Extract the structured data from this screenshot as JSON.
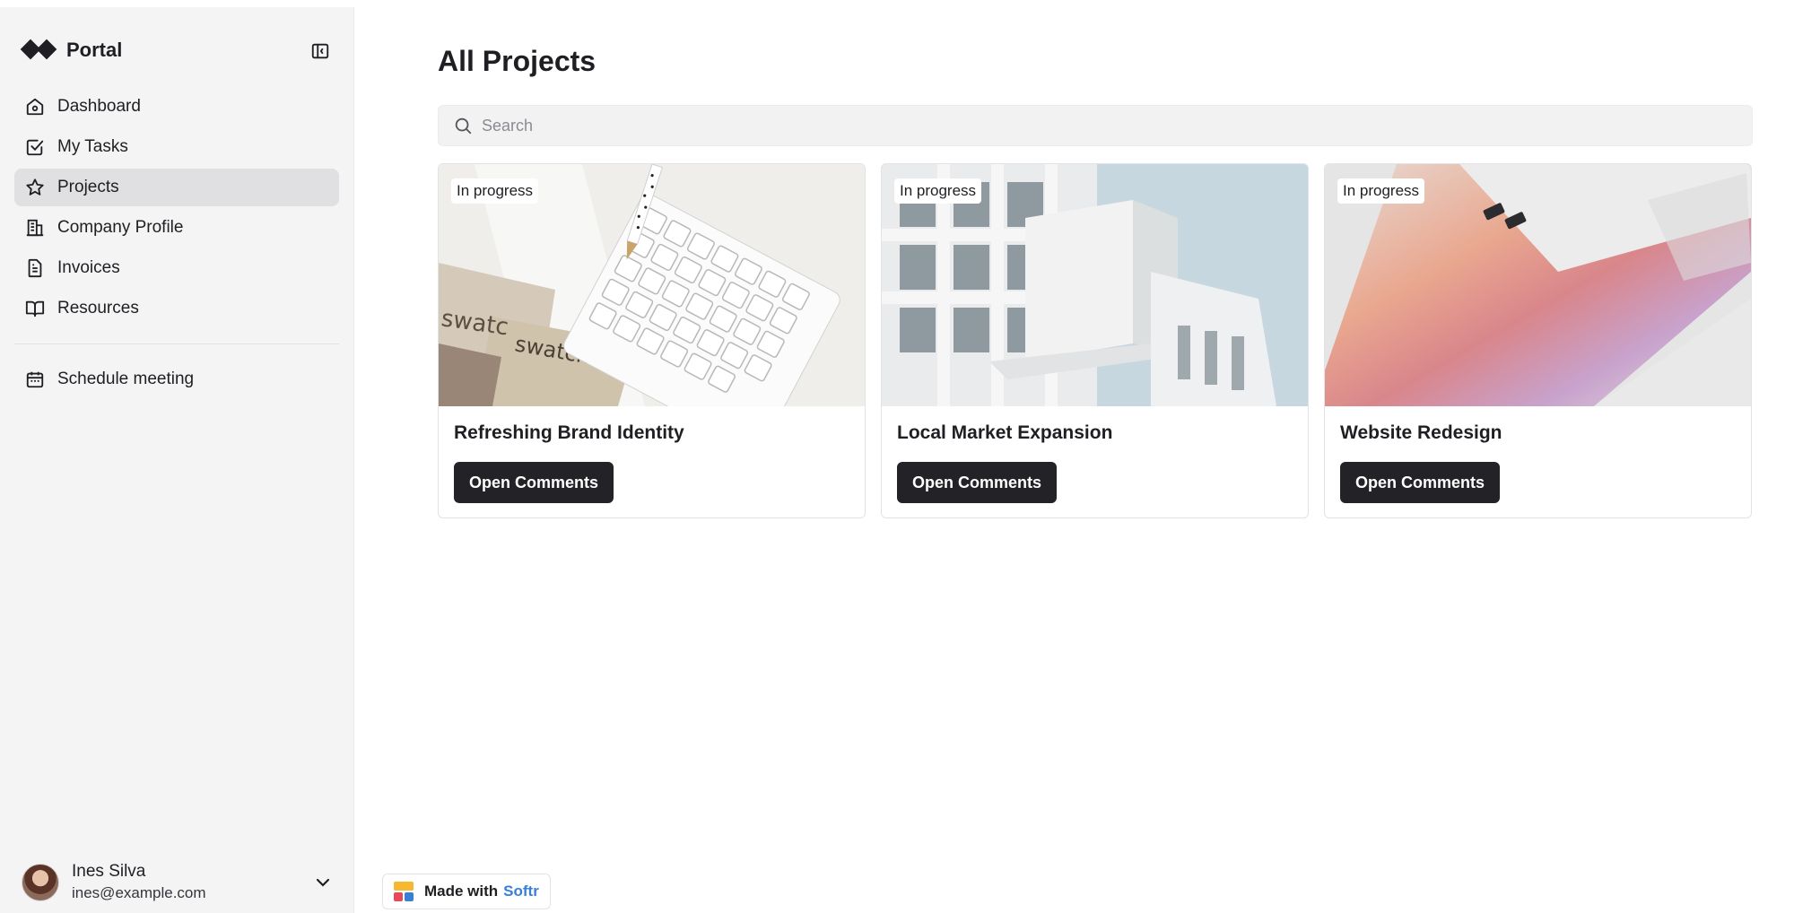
{
  "app": {
    "name": "Portal"
  },
  "sidebar": {
    "items": [
      {
        "label": "Dashboard",
        "icon": "home-icon"
      },
      {
        "label": "My Tasks",
        "icon": "checkbox-icon"
      },
      {
        "label": "Projects",
        "icon": "star-icon",
        "active": true
      },
      {
        "label": "Company Profile",
        "icon": "building-icon"
      },
      {
        "label": "Invoices",
        "icon": "document-icon"
      },
      {
        "label": "Resources",
        "icon": "book-icon"
      }
    ],
    "secondary_items": [
      {
        "label": "Schedule meeting",
        "icon": "calendar-icon"
      }
    ],
    "user": {
      "name": "Ines Silva",
      "email": "ines@example.com"
    }
  },
  "main": {
    "title": "All Projects",
    "search": {
      "placeholder": "Search",
      "value": ""
    },
    "projects": [
      {
        "status": "In progress",
        "title": "Refreshing Brand Identity",
        "button_label": "Open Comments"
      },
      {
        "status": "In progress",
        "title": "Local Market Expansion",
        "button_label": "Open Comments"
      },
      {
        "status": "In progress",
        "title": "Website Redesign",
        "button_label": "Open Comments"
      }
    ]
  },
  "footer_badge": {
    "text": "Made with",
    "brand": "Softr"
  },
  "colors": {
    "sidebar_bg": "#f4f4f5",
    "active_nav_bg": "#e0e0e2",
    "button_bg": "#232327",
    "brand_link": "#3a7fd6"
  }
}
